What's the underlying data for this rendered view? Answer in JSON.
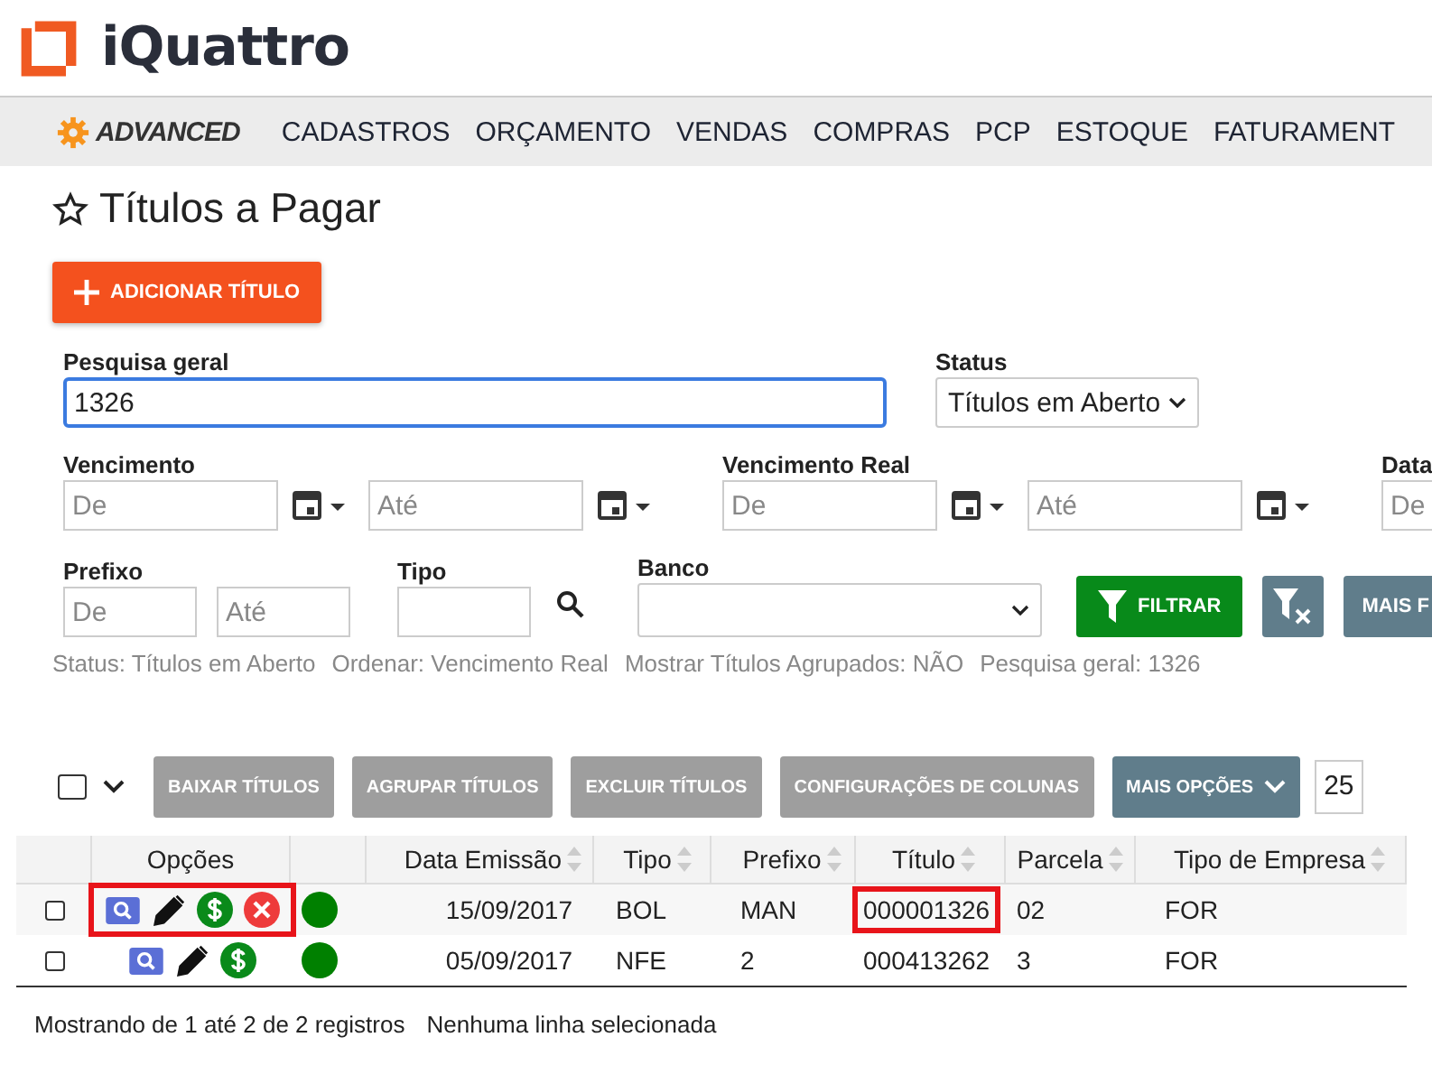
{
  "brand": {
    "name": "iQuattro",
    "edition": "ADVANCED"
  },
  "menu": [
    "CADASTROS",
    "ORÇAMENTO",
    "VENDAS",
    "COMPRAS",
    "PCP",
    "ESTOQUE",
    "FATURAMENT"
  ],
  "page_title": "Títulos a Pagar",
  "add_button": "ADICIONAR TÍTULO",
  "filters": {
    "search": {
      "label": "Pesquisa geral",
      "value": "1326"
    },
    "status": {
      "label": "Status",
      "value": "Títulos em Aberto"
    },
    "vencimento": {
      "label": "Vencimento",
      "from_placeholder": "De",
      "to_placeholder": "Até"
    },
    "vencimento_real": {
      "label": "Vencimento Real",
      "from_placeholder": "De",
      "to_placeholder": "Até"
    },
    "data": {
      "label": "Data",
      "from_placeholder": "De"
    },
    "prefixo": {
      "label": "Prefixo",
      "from_placeholder": "De",
      "to_placeholder": "Até"
    },
    "tipo": {
      "label": "Tipo"
    },
    "banco": {
      "label": "Banco"
    },
    "filter_button": "FILTRAR",
    "more_button": "MAIS F"
  },
  "summary": [
    "Status: Títulos em Aberto",
    "Ordenar: Vencimento Real",
    "Mostrar Títulos Agrupados: NÃO",
    "Pesquisa geral: 1326"
  ],
  "toolbar": {
    "select_all_checked": false,
    "buttons": [
      "BAIXAR TÍTULOS",
      "AGRUPAR TÍTULOS",
      "EXCLUIR TÍTULOS",
      "CONFIGURAÇÕES DE COLUNAS"
    ],
    "more": "MAIS OPÇÕES",
    "page_size": "25"
  },
  "table": {
    "options_header": "Opções",
    "columns": [
      "Data Emissão",
      "Tipo",
      "Prefixo",
      "Título",
      "Parcela",
      "Tipo de Empresa"
    ],
    "rows": [
      {
        "checked": false,
        "can_delete": true,
        "color": "#008000",
        "highlight_options": true,
        "highlight_titulo": true,
        "cells": [
          "15/09/2017",
          "BOL",
          "MAN",
          "000001326",
          "02",
          "FOR"
        ]
      },
      {
        "checked": false,
        "can_delete": false,
        "color": "#008000",
        "highlight_options": false,
        "highlight_titulo": false,
        "cells": [
          "05/09/2017",
          "NFE",
          "2",
          "000413262",
          "3",
          "FOR"
        ]
      }
    ]
  },
  "footer": [
    "Mostrando de 1 até 2 de 2 registros",
    "Nenhuma linha selecionada"
  ]
}
